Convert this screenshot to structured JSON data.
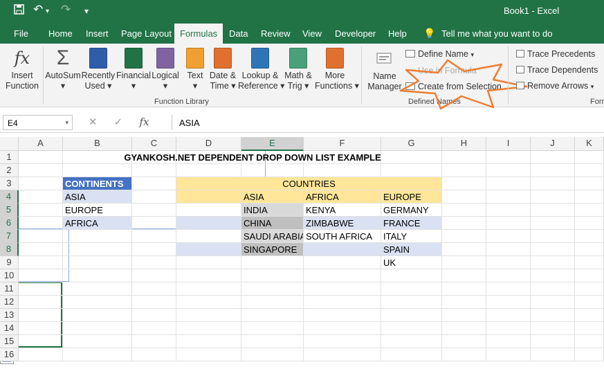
{
  "window": {
    "title": "Book1  -  Excel"
  },
  "qat": {
    "undo_glyph": "↶",
    "redo_glyph": "↷",
    "more_glyph": "▾"
  },
  "tabs": [
    "File",
    "Home",
    "Insert",
    "Page Layout",
    "Formulas",
    "Data",
    "Review",
    "View",
    "Developer",
    "Help"
  ],
  "tell_me": "Tell me what you want to do",
  "ribbon": {
    "insert_function": [
      "Insert",
      "Function"
    ],
    "library": [
      {
        "l1": "AutoSum",
        "l2": "▾",
        "icon": "sigma-icon",
        "color": "#555555"
      },
      {
        "l1": "Recently",
        "l2": "Used ▾",
        "icon": "star-book-icon",
        "color": "#2e5eaa"
      },
      {
        "l1": "Financial",
        "l2": "▾",
        "icon": "financial-book-icon",
        "color": "#217346"
      },
      {
        "l1": "Logical",
        "l2": "▾",
        "icon": "question-book-icon",
        "color": "#8064a2"
      },
      {
        "l1": "Text",
        "l2": "▾",
        "icon": "text-book-icon",
        "color": "#f0a030"
      },
      {
        "l1": "Date &",
        "l2": "Time ▾",
        "icon": "date-book-icon",
        "color": "#e07030"
      },
      {
        "l1": "Lookup &",
        "l2": "Reference ▾",
        "icon": "lookup-book-icon",
        "color": "#2e75b6"
      },
      {
        "l1": "Math &",
        "l2": "Trig ▾",
        "icon": "theta-book-icon",
        "color": "#4aa07a"
      },
      {
        "l1": "More",
        "l2": "Functions ▾",
        "icon": "more-book-icon",
        "color": "#e07030"
      }
    ],
    "function_library_label": "Function Library",
    "name_manager": [
      "Name",
      "Manager"
    ],
    "define_name": "Define Name",
    "use_in_formula": "Use in Formula",
    "create_from_selection": "Create from Selection",
    "defined_names_label": "Defined Names",
    "trace_precedents": "Trace Precedents",
    "trace_dependents": "Trace Dependents",
    "remove_arrows": "Remove Arrows",
    "formula_auditing_label": "Forr",
    "star_color": "#ed7d31"
  },
  "formula_bar": {
    "name_box": "E4",
    "value": "ASIA"
  },
  "columns": [
    "A",
    "B",
    "C",
    "D",
    "E",
    "F",
    "G",
    "H",
    "I",
    "J",
    "K"
  ],
  "rows": [
    "1",
    "2",
    "3",
    "4",
    "5",
    "6",
    "7",
    "8",
    "9",
    "10",
    "11",
    "12",
    "13",
    "14",
    "15",
    "16"
  ],
  "sheet": {
    "title": "GYANKOSH.NET DEPENDENT DROP DOWN LIST EXAMPLE",
    "continents_header": "CONTINENTS",
    "continents": [
      "ASIA",
      "EUROPE",
      "AFRICA"
    ],
    "countries_header": "COUNTRIES",
    "col_e": [
      "ASIA",
      "INDIA",
      "CHINA",
      "SAUDI ARABIA",
      "SINGAPORE"
    ],
    "col_f": [
      "AFRICA",
      "KENYA",
      "ZIMBABWE",
      "SOUTH AFRICA"
    ],
    "col_g": [
      "EUROPE",
      "GERMANY",
      "FRANCE",
      "ITALY",
      "SPAIN",
      "UK"
    ]
  }
}
